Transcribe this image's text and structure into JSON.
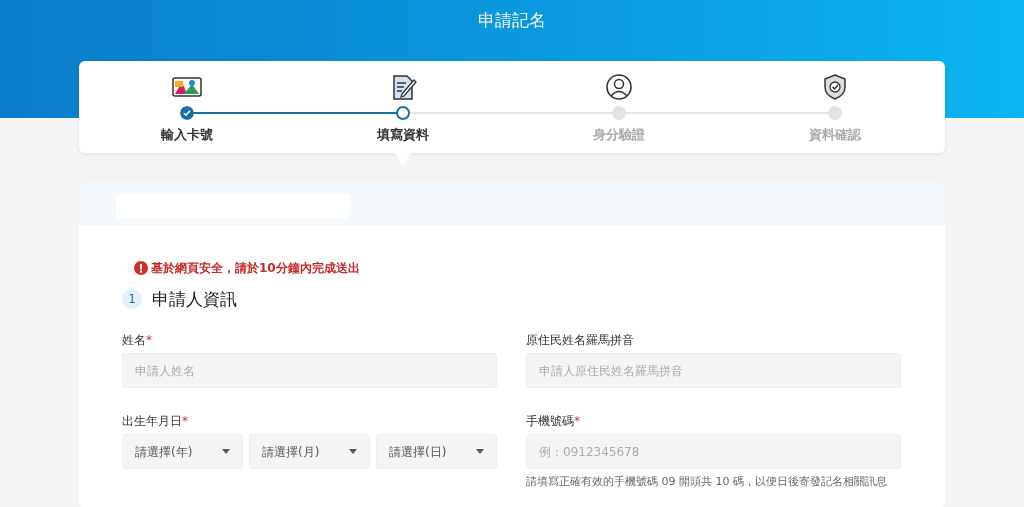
{
  "header": {
    "title": "申請記名"
  },
  "steps": [
    {
      "label": "輸入卡號",
      "done": true,
      "selected": false
    },
    {
      "label": "填寫資料",
      "done": false,
      "selected": true
    },
    {
      "label": "身分驗證",
      "done": false,
      "selected": false
    },
    {
      "label": "資料確認",
      "done": false,
      "selected": false
    }
  ],
  "form": {
    "warning": "基於網頁安全，請於10分鐘內完成送出",
    "section": {
      "number": "1",
      "title": "申請人資訊"
    },
    "fields": [
      {
        "kind": "text",
        "label": "姓名",
        "required_mark": "*",
        "placeholder": "申請人姓名"
      },
      {
        "kind": "text",
        "label": "原住民姓名羅馬拼音",
        "placeholder": "申請人原住民姓名羅馬拼音"
      },
      {
        "kind": "selects",
        "label": "出生年月日",
        "required_mark": "*",
        "selects": [
          {
            "placeholder": "請選擇(年)"
          },
          {
            "placeholder": "請選擇(月)"
          },
          {
            "placeholder": "請選擇(日)"
          }
        ]
      },
      {
        "kind": "text",
        "label": "手機號碼",
        "required_mark": "*",
        "placeholder": "例：0912345678",
        "hint": "請填寫正確有效的手機號碼 09 開頭共 10 碼，以便日後寄發記名相關訊息"
      }
    ]
  }
}
